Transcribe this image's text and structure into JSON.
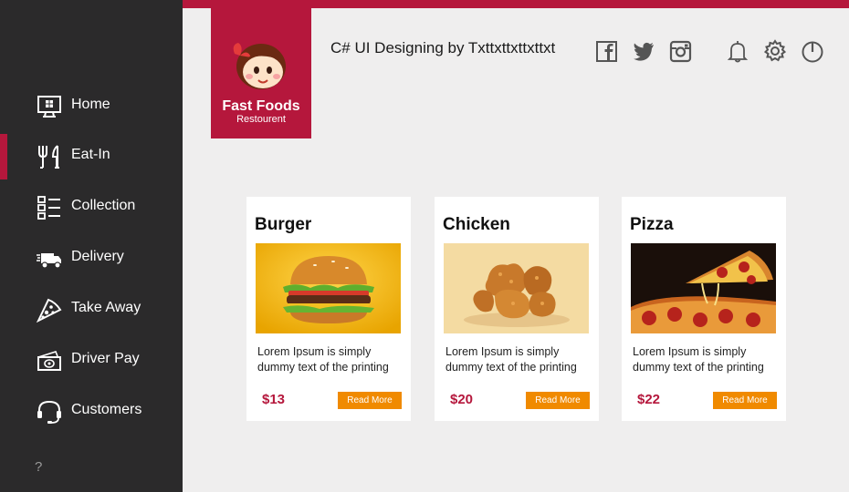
{
  "sidebar": {
    "items": [
      {
        "label": "Home",
        "icon": "monitor-icon",
        "active": false
      },
      {
        "label": "Eat-In",
        "icon": "fork-knife-icon",
        "active": true
      },
      {
        "label": "Collection",
        "icon": "checklist-icon",
        "active": false
      },
      {
        "label": "Delivery",
        "icon": "truck-icon",
        "active": false
      },
      {
        "label": "Take Away",
        "icon": "pizza-slice-icon",
        "active": false
      },
      {
        "label": "Driver Pay",
        "icon": "cash-icon",
        "active": false
      },
      {
        "label": "Customers",
        "icon": "headset-icon",
        "active": false
      }
    ],
    "help_label": "?"
  },
  "brand": {
    "title": "Fast Foods",
    "subtitle": "Restourent"
  },
  "header": {
    "title": "C# UI Designing by Txttxttxttxttxt",
    "icons": [
      "facebook-icon",
      "twitter-icon",
      "instagram-icon",
      "bell-icon",
      "gear-icon",
      "power-icon"
    ]
  },
  "cards": [
    {
      "title": "Burger",
      "description": "Lorem Ipsum is simply dummy text of the printing",
      "price": "$13",
      "button": "Read More"
    },
    {
      "title": "Chicken",
      "description": "Lorem Ipsum is simply dummy text of the printing",
      "price": "$20",
      "button": "Read More"
    },
    {
      "title": "Pizza",
      "description": "Lorem Ipsum is simply dummy text of the printing",
      "price": "$22",
      "button": "Read More"
    }
  ],
  "colors": {
    "accent": "#b5173c",
    "sidebar": "#2b2a2b",
    "background": "#efeeee",
    "button": "#f08a00"
  }
}
